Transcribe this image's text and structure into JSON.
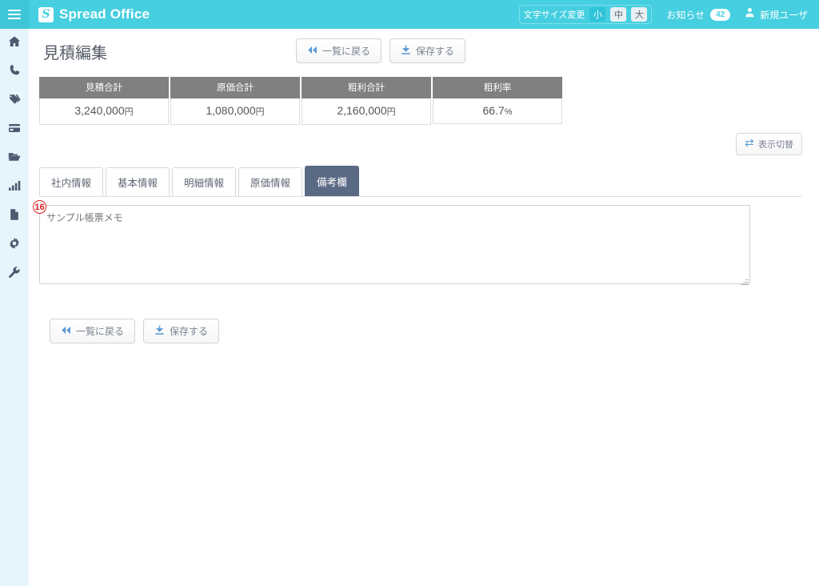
{
  "header": {
    "menu_icon": "hamburger-icon",
    "brand": "Spread Office",
    "brand_mark": "spreadoffice-logo-icon",
    "fontsize": {
      "label": "文字サイズ変更",
      "options": [
        "小",
        "中",
        "大"
      ],
      "selected": "小"
    },
    "notice": {
      "label": "お知らせ",
      "count": "42"
    },
    "user": {
      "icon": "user-icon",
      "name": "新規ユーザ"
    }
  },
  "sidebar": {
    "items": [
      {
        "icon": "home-icon",
        "name": "sidebar-item-home"
      },
      {
        "icon": "phone-icon",
        "name": "sidebar-item-phone"
      },
      {
        "icon": "tags-icon",
        "name": "sidebar-item-tags"
      },
      {
        "icon": "card-icon",
        "name": "sidebar-item-card"
      },
      {
        "icon": "folder-icon",
        "name": "sidebar-item-folder"
      },
      {
        "icon": "bar-chart-icon",
        "name": "sidebar-item-report"
      },
      {
        "icon": "document-icon",
        "name": "sidebar-item-document"
      },
      {
        "icon": "gear-icon",
        "name": "sidebar-item-settings"
      },
      {
        "icon": "wrench-icon",
        "name": "sidebar-item-tools"
      }
    ]
  },
  "page": {
    "title": "見積編集",
    "back_label": "一覧に戻る",
    "save_label": "保存する",
    "back_icon": "rewind-icon",
    "save_icon": "download-icon"
  },
  "summary": {
    "columns": [
      {
        "header": "見積合計",
        "value": "3,240,000",
        "unit": "円"
      },
      {
        "header": "原価合計",
        "value": "1,080,000",
        "unit": "円"
      },
      {
        "header": "粗利合計",
        "value": "2,160,000",
        "unit": "円"
      },
      {
        "header": "粗利率",
        "value": "66.7",
        "unit": "%"
      }
    ]
  },
  "toggle": {
    "label": "表示切替",
    "icon": "swap-arrows-icon"
  },
  "tabs": [
    {
      "label": "社内情報",
      "active": false
    },
    {
      "label": "基本情報",
      "active": false
    },
    {
      "label": "明細情報",
      "active": false
    },
    {
      "label": "原価情報",
      "active": false
    },
    {
      "label": "備考欄",
      "active": true
    }
  ],
  "memo": {
    "marker": "16",
    "value": "サンプル帳票メモ",
    "placeholder": ""
  },
  "colors": {
    "brand": "#45cfe0",
    "sidebar": "#e6f5fb",
    "tab_active": "#5a6a85",
    "summary_header": "#808080",
    "marker": "#e02020",
    "icon_blue": "#5b9bd5"
  }
}
